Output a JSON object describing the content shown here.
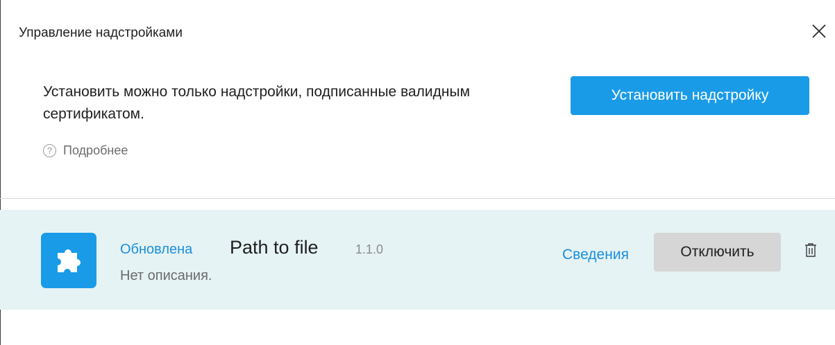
{
  "dialog": {
    "title": "Управление надстройками"
  },
  "notice": {
    "text": "Установить можно только надстройки, подписанные валидным сертификатом.",
    "learn_more": "Подробнее",
    "learn_more_icon": "question-circle-icon"
  },
  "actions": {
    "install_label": "Установить надстройку"
  },
  "addons": [
    {
      "status": "Обновлена",
      "name": "Path to file",
      "version": "1.1.0",
      "description": "Нет описания.",
      "details_label": "Сведения",
      "disable_label": "Отключить",
      "icon": "puzzle-icon"
    }
  ],
  "colors": {
    "accent": "#1a9be8",
    "link": "#1a8fdc",
    "row_background": "#e6f3f4",
    "secondary_button": "#d6d6d6"
  }
}
